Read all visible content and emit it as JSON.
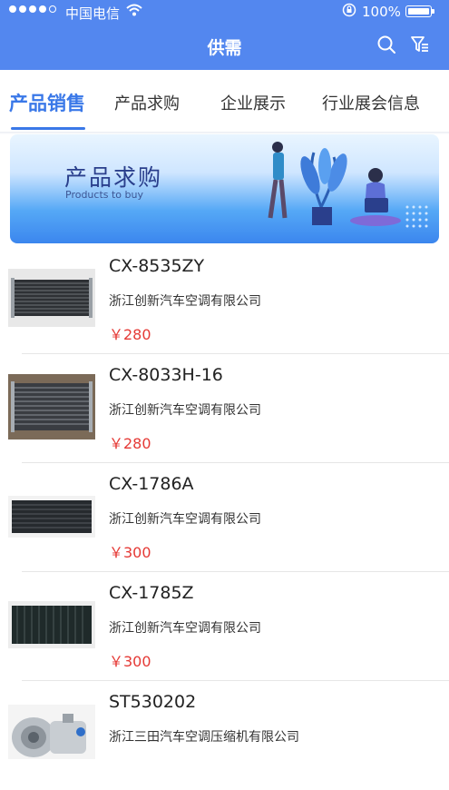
{
  "status": {
    "carrier": "中国电信",
    "battery": "100%"
  },
  "nav": {
    "title": "供需"
  },
  "tabs": [
    {
      "label": "产品销售",
      "active": true
    },
    {
      "label": "产品求购",
      "active": false
    },
    {
      "label": "企业展示",
      "active": false
    },
    {
      "label": "行业展会信息",
      "active": false
    }
  ],
  "banner": {
    "title": "产品求购",
    "subtitle": "Products to buy"
  },
  "products": [
    {
      "name": "CX-8535ZY",
      "company": "浙江创新汽车空调有限公司",
      "price": "￥280"
    },
    {
      "name": "CX-8033H-16",
      "company": "浙江创新汽车空调有限公司",
      "price": "￥280"
    },
    {
      "name": "CX-1786A",
      "company": "浙江创新汽车空调有限公司",
      "price": "￥300"
    },
    {
      "name": "CX-1785Z",
      "company": "浙江创新汽车空调有限公司",
      "price": "￥300"
    },
    {
      "name": "ST530202",
      "company": "浙江三田汽车空调压缩机有限公司",
      "price": ""
    }
  ],
  "colors": {
    "header": "#5387ef",
    "accent": "#3a78e8",
    "price": "#e53935"
  }
}
